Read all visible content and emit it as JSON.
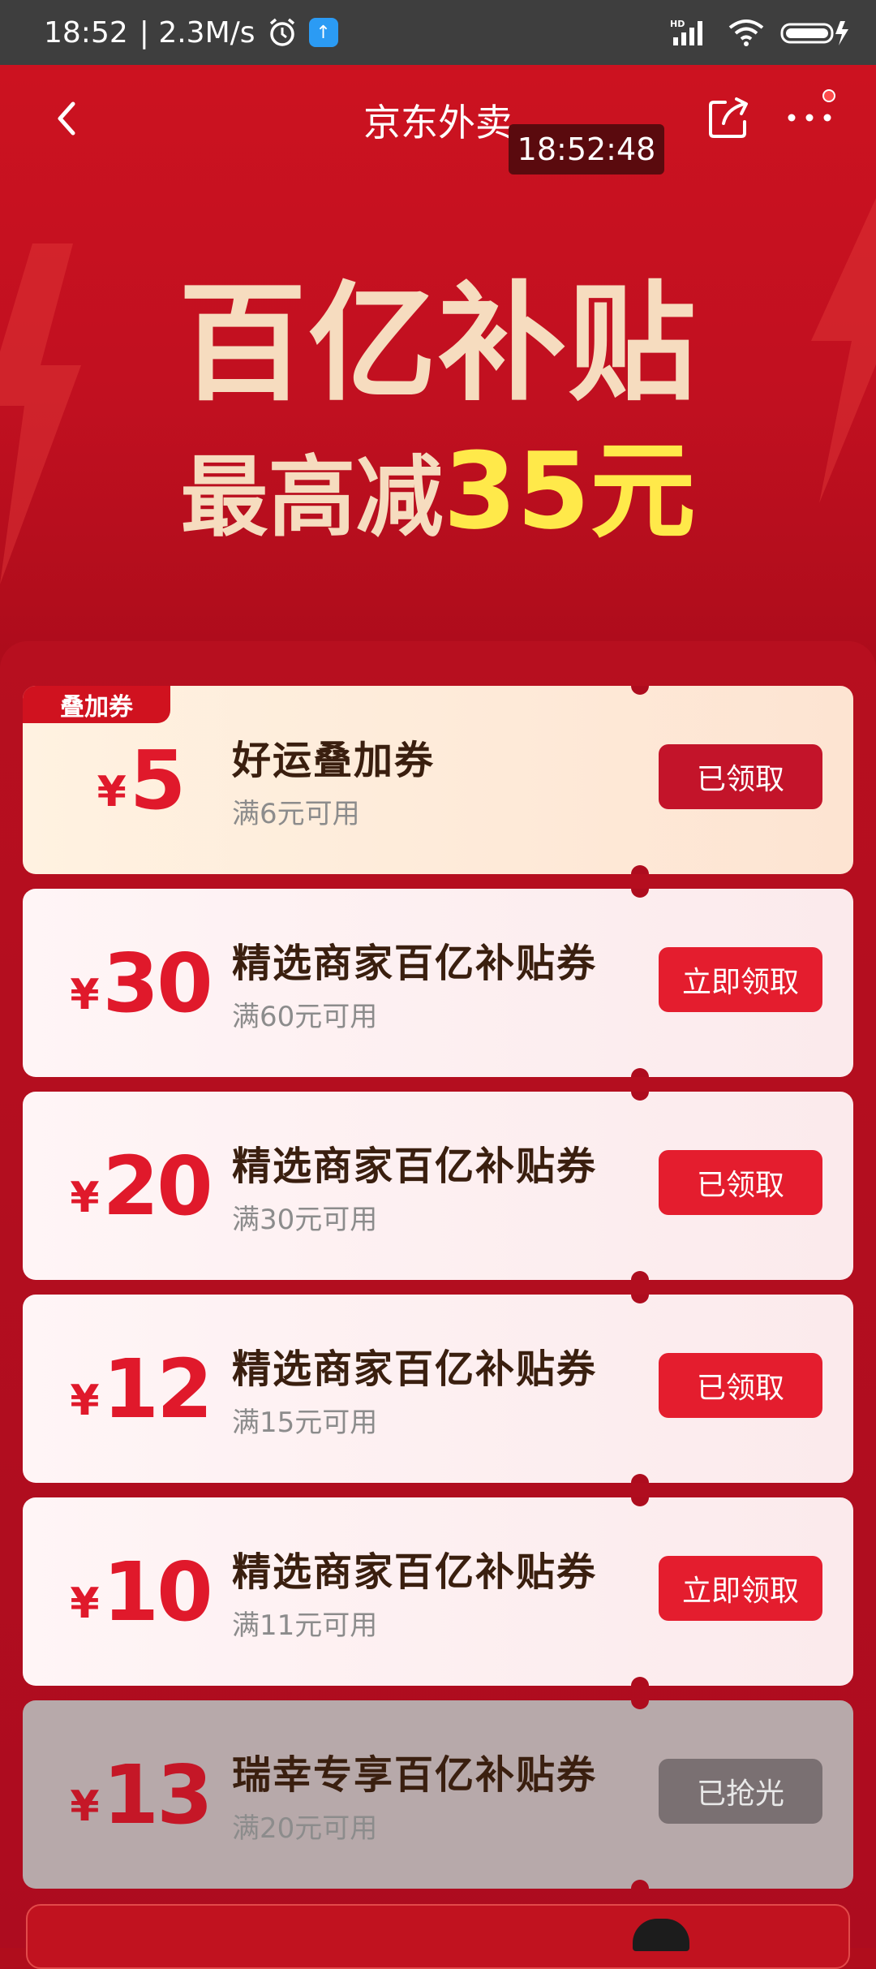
{
  "status_bar": {
    "time": "18:52",
    "speed": "| 2.3M/s",
    "alarm_icon": "alarm-icon",
    "upload_icon": "upload-icon",
    "network": "HD",
    "battery_icon": "battery-icon"
  },
  "navbar": {
    "title": "京东外卖",
    "time_badge": "18:52:48"
  },
  "hero": {
    "title": "百亿补贴",
    "subtitle_prefix": "最高减",
    "subtitle_highlight": "35元"
  },
  "coupons": [
    {
      "tag": "叠加券",
      "currency": "¥",
      "amount": "5",
      "title": "好运叠加券",
      "condition": "满6元可用",
      "button": "已领取",
      "state": "claimed"
    },
    {
      "currency": "¥",
      "amount": "30",
      "title": "精选商家百亿补贴券",
      "condition": "满60元可用",
      "button": "立即领取",
      "state": "available"
    },
    {
      "currency": "¥",
      "amount": "20",
      "title": "精选商家百亿补贴券",
      "condition": "满30元可用",
      "button": "已领取",
      "state": "claimed"
    },
    {
      "currency": "¥",
      "amount": "12",
      "title": "精选商家百亿补贴券",
      "condition": "满15元可用",
      "button": "已领取",
      "state": "claimed"
    },
    {
      "currency": "¥",
      "amount": "10",
      "title": "精选商家百亿补贴券",
      "condition": "满11元可用",
      "button": "立即领取",
      "state": "available"
    },
    {
      "currency": "¥",
      "amount": "13",
      "title": "瑞幸专享百亿补贴券",
      "condition": "满20元可用",
      "button": "已抢光",
      "state": "sold_out"
    }
  ],
  "colors": {
    "primary_red": "#e41d2e",
    "hero_red": "#c11020",
    "highlight_yellow": "#ffe94a",
    "cream": "#f6dcbf"
  }
}
